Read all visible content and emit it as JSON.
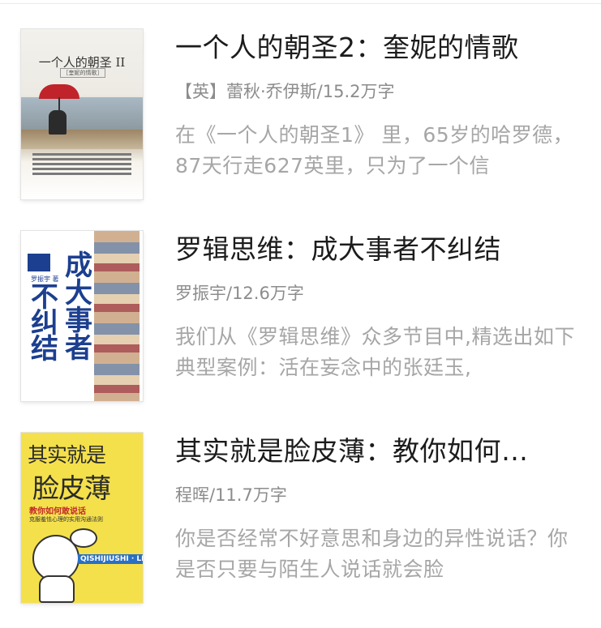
{
  "books": [
    {
      "title": "一个人的朝圣2：奎妮的情歌",
      "meta": "【英】蕾秋·乔伊斯/15.2万字",
      "desc": "在《一个人的朝圣1》 里，65岁的哈罗德，87天行走627英里，只为了一个信"
    },
    {
      "title": "罗辑思维：成大事者不纠结",
      "meta": "罗振宇/12.6万字",
      "desc": "我们从《罗辑思维》众多节目中,精选出如下典型案例：活在妄念中的张廷玉,"
    },
    {
      "title": "其实就是脸皮薄：教你如何…",
      "meta": "程晖/11.7万字",
      "desc": "你是否经常不好意思和身边的异性说话？你是否只要与陌生人说话就会脸"
    }
  ]
}
